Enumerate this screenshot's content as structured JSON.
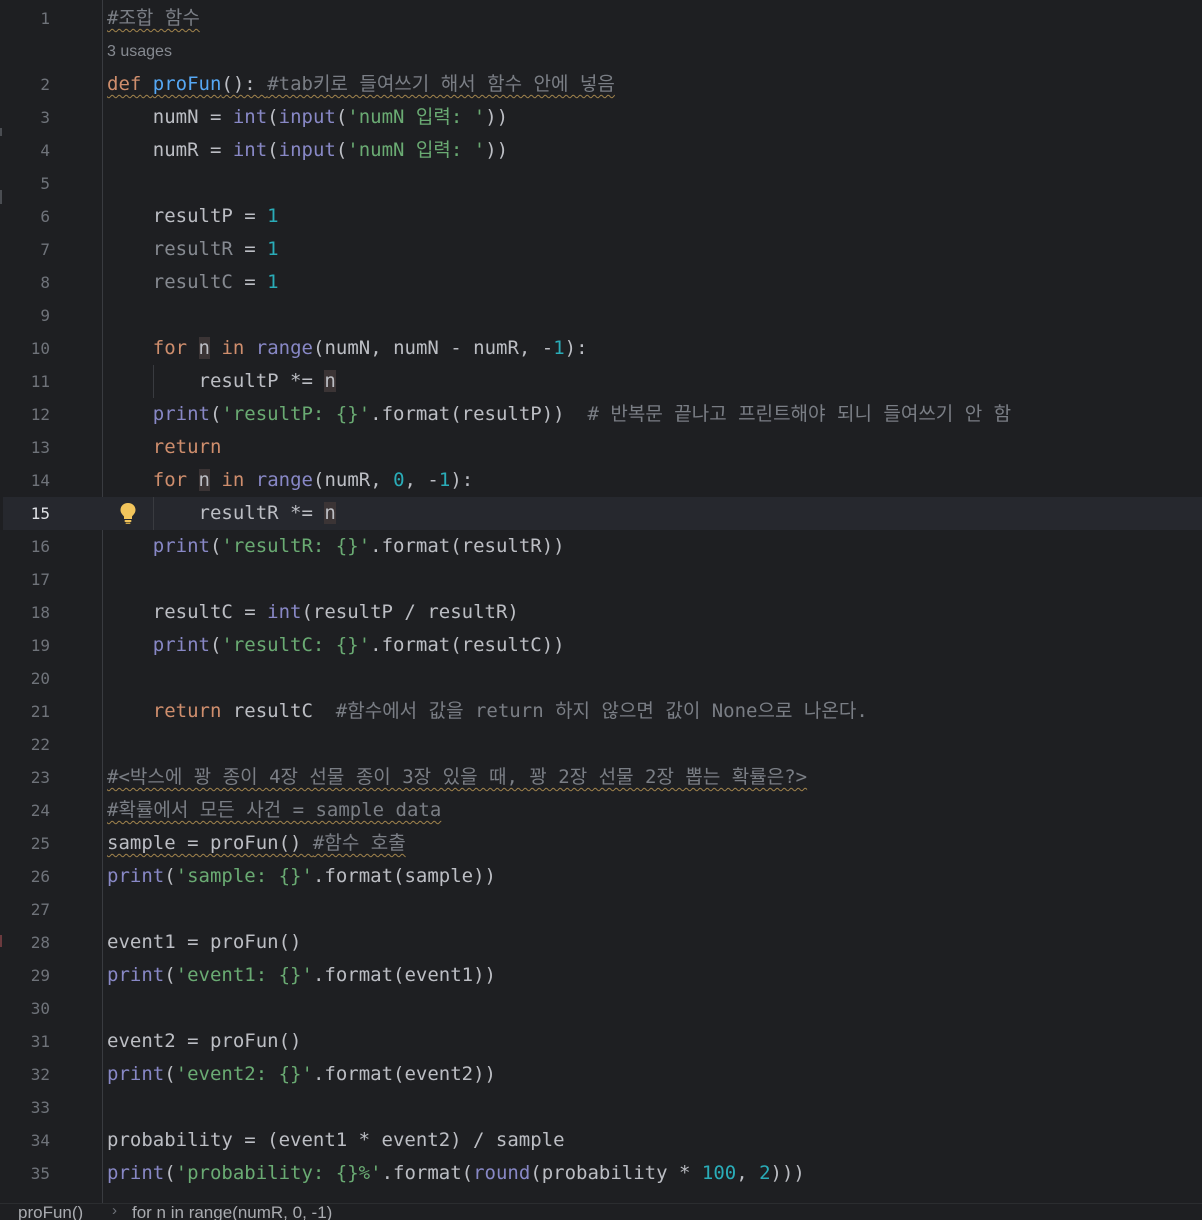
{
  "editor": {
    "current_line": 15,
    "usage_hint": "3 usages",
    "lines": [
      {
        "n": "1",
        "text": "#조합 함수"
      },
      {
        "n": "2",
        "text": "def proFun(): #tab키로 들여쓰기 해서 함수 안에 넣음"
      },
      {
        "n": "3",
        "text": "    numN = int(input('numN 입력: '))"
      },
      {
        "n": "4",
        "text": "    numR = int(input('numN 입력: '))"
      },
      {
        "n": "5",
        "text": ""
      },
      {
        "n": "6",
        "text": "    resultP = 1"
      },
      {
        "n": "7",
        "text": "    resultR = 1"
      },
      {
        "n": "8",
        "text": "    resultC = 1"
      },
      {
        "n": "9",
        "text": ""
      },
      {
        "n": "10",
        "text": "    for n in range(numN, numN - numR, -1):"
      },
      {
        "n": "11",
        "text": "        resultP *= n"
      },
      {
        "n": "12",
        "text": "    print('resultP: {}'.format(resultP))  # 반복문 끝나고 프린트해야 되니 들여쓰기 안 함"
      },
      {
        "n": "13",
        "text": "    return"
      },
      {
        "n": "14",
        "text": "    for n in range(numR, 0, -1):"
      },
      {
        "n": "15",
        "text": "        resultR *= n"
      },
      {
        "n": "16",
        "text": "    print('resultR: {}'.format(resultR))"
      },
      {
        "n": "17",
        "text": ""
      },
      {
        "n": "18",
        "text": "    resultC = int(resultP / resultR)"
      },
      {
        "n": "19",
        "text": "    print('resultC: {}'.format(resultC))"
      },
      {
        "n": "20",
        "text": ""
      },
      {
        "n": "21",
        "text": "    return resultC  #함수에서 값을 return 하지 않으면 값이 None으로 나온다."
      },
      {
        "n": "22",
        "text": ""
      },
      {
        "n": "23",
        "text": "#<박스에 꽝 종이 4장 선물 종이 3장 있을 때, 꽝 2장 선물 2장 뽑는 확률은?>"
      },
      {
        "n": "24",
        "text": "#확률에서 모든 사건 = sample data"
      },
      {
        "n": "25",
        "text": "sample = proFun() #함수 호출"
      },
      {
        "n": "26",
        "text": "print('sample: {}'.format(sample))"
      },
      {
        "n": "27",
        "text": ""
      },
      {
        "n": "28",
        "text": "event1 = proFun()"
      },
      {
        "n": "29",
        "text": "print('event1: {}'.format(event1))"
      },
      {
        "n": "30",
        "text": ""
      },
      {
        "n": "31",
        "text": "event2 = proFun()"
      },
      {
        "n": "32",
        "text": "print('event2: {}'.format(event2))"
      },
      {
        "n": "33",
        "text": ""
      },
      {
        "n": "34",
        "text": "probability = (event1 * event2) / sample"
      },
      {
        "n": "35",
        "text": "print('probability: {}%'.format(round(probability * 100, 2)))"
      }
    ]
  },
  "breadcrumb": {
    "items": [
      "proFun()",
      "for n in range(numR, 0, -1)"
    ],
    "separator": "›"
  },
  "icons": {
    "intention_bulb": "lightbulb-icon"
  },
  "colors": {
    "background": "#1e1f22",
    "keyword": "#cf8e6d",
    "function": "#56a8f5",
    "builtin": "#8888c6",
    "string": "#6aab73",
    "number": "#2aacb8",
    "comment": "#7a7e85",
    "text": "#bcbec4",
    "bulb": "#f2c55c"
  }
}
